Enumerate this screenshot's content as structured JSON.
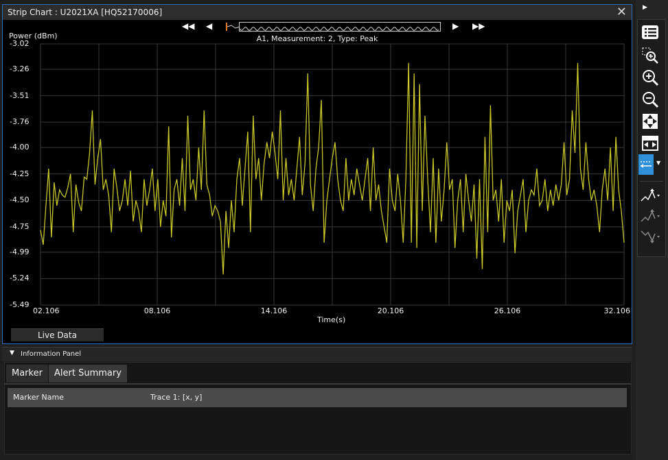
{
  "window": {
    "title": "Strip Chart : U2021XA [HQ52170006]",
    "close_glyph": "✕"
  },
  "nav": {
    "first": "◀◀",
    "prev": "◀",
    "next": "▶",
    "last": "▶▶"
  },
  "chart_data": {
    "type": "line",
    "title": "A1, Measurement: 2, Type: Peak",
    "ylabel": "Power (dBm)",
    "xlabel": "Time(s)",
    "ylim": [
      -5.49,
      -3.02
    ],
    "xlim": [
      2.106,
      32.106
    ],
    "yticks": [
      "-3.02",
      "-3.26",
      "-3.51",
      "-3.76",
      "-4.00",
      "-4.25",
      "-4.50",
      "-4.75",
      "-4.99",
      "-5.24",
      "-5.49"
    ],
    "xticks": [
      "02.106",
      "08.106",
      "14.106",
      "20.106",
      "26.106",
      "32.106"
    ],
    "grid": true,
    "line_color": "#c8c82a",
    "series": [
      {
        "values": [
          -4.78,
          -4.92,
          -4.55,
          -4.2,
          -4.85,
          -4.33,
          -4.55,
          -4.4,
          -4.45,
          -4.47,
          -4.38,
          -4.25,
          -4.8,
          -4.35,
          -4.52,
          -4.6,
          -4.28,
          -4.3,
          -4.05,
          -3.65,
          -4.35,
          -4.1,
          -3.92,
          -4.4,
          -4.3,
          -4.45,
          -4.8,
          -4.2,
          -4.38,
          -4.6,
          -4.5,
          -4.3,
          -4.55,
          -4.22,
          -4.7,
          -4.5,
          -4.6,
          -4.8,
          -4.3,
          -4.55,
          -4.4,
          -4.2,
          -4.6,
          -4.3,
          -4.75,
          -4.5,
          -4.65,
          -3.8,
          -4.85,
          -4.4,
          -4.3,
          -4.55,
          -4.1,
          -4.6,
          -3.7,
          -4.4,
          -4.3,
          -4.5,
          -4.0,
          -4.4,
          -3.65,
          -4.35,
          -4.45,
          -4.65,
          -4.55,
          -4.6,
          -4.7,
          -5.2,
          -4.6,
          -4.95,
          -4.5,
          -4.8,
          -4.3,
          -4.1,
          -4.55,
          -4.2,
          -3.85,
          -4.8,
          -3.7,
          -4.3,
          -4.1,
          -4.5,
          -4.15,
          -3.95,
          -4.1,
          -3.85,
          -4.05,
          -4.3,
          -3.65,
          -4.5,
          -4.1,
          -4.45,
          -4.3,
          -4.5,
          -4.2,
          -3.9,
          -4.45,
          -4.15,
          -3.3,
          -4.35,
          -4.6,
          -4.2,
          -4.0,
          -3.55,
          -4.9,
          -4.5,
          -4.3,
          -4.1,
          -3.95,
          -4.3,
          -4.5,
          -4.6,
          -4.1,
          -4.5,
          -4.3,
          -4.45,
          -4.2,
          -4.35,
          -4.5,
          -4.3,
          -4.1,
          -4.6,
          -4.0,
          -4.5,
          -4.35,
          -4.6,
          -4.75,
          -4.9,
          -4.2,
          -4.5,
          -4.6,
          -4.25,
          -4.5,
          -4.9,
          -4.3,
          -3.2,
          -4.9,
          -3.3,
          -4.95,
          -3.4,
          -4.6,
          -3.7,
          -4.3,
          -4.8,
          -4.1,
          -4.9,
          -4.2,
          -4.7,
          -4.4,
          -3.95,
          -4.4,
          -4.3,
          -4.95,
          -4.5,
          -4.3,
          -4.8,
          -4.25,
          -4.5,
          -4.7,
          -4.35,
          -5.05,
          -4.3,
          -5.15,
          -3.9,
          -4.8,
          -3.6,
          -4.5,
          -4.4,
          -4.7,
          -4.3,
          -4.9,
          -4.5,
          -4.6,
          -4.4,
          -5.0,
          -4.6,
          -4.45,
          -4.3,
          -4.8,
          -4.5,
          -4.4,
          -4.45,
          -4.2,
          -4.55,
          -4.5,
          -4.3,
          -4.6,
          -4.4,
          -4.55,
          -4.35,
          -4.5,
          -4.35,
          -3.95,
          -4.45,
          -4.3,
          -3.65,
          -4.05,
          -3.2,
          -4.2,
          -4.4,
          -3.95,
          -4.3,
          -4.5,
          -4.4,
          -4.55,
          -4.8,
          -4.4,
          -4.2,
          -4.5,
          -4.0,
          -4.6,
          -3.9,
          -4.4,
          -4.6,
          -4.9
        ]
      }
    ]
  },
  "live_data_label": "Live Data",
  "info_panel": {
    "title": "Information Panel",
    "tabs": [
      "Marker",
      "Alert Summary"
    ],
    "columns": [
      "Marker Name",
      "Trace 1: [x, y]"
    ]
  },
  "toolbar": {
    "expand_glyph": "▶",
    "active_color": "#2f8fd8"
  }
}
